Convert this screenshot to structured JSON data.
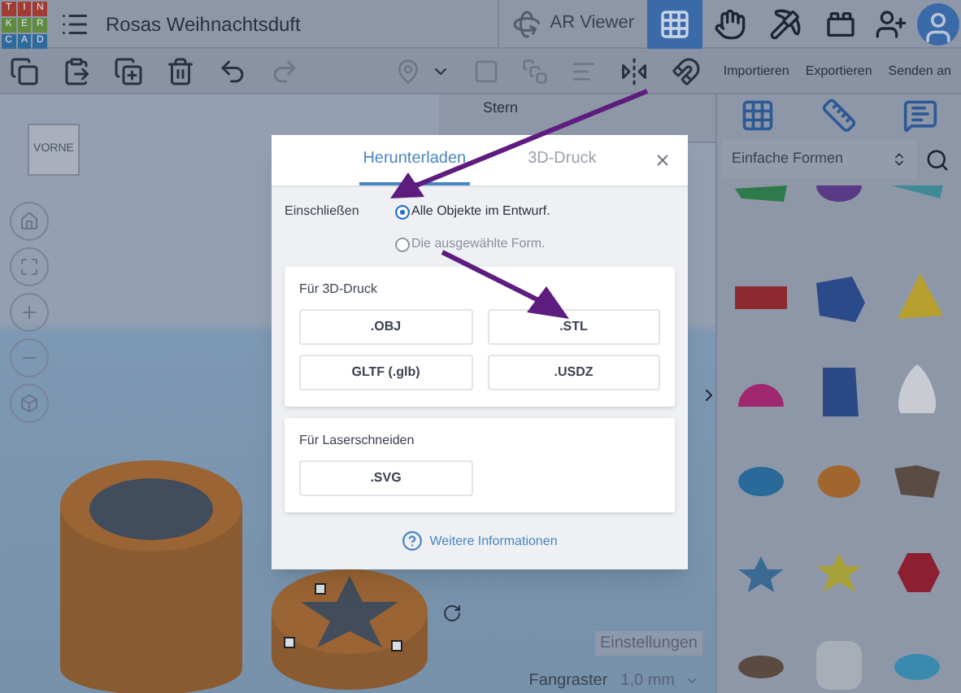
{
  "header": {
    "logo_letters": [
      "T",
      "I",
      "N",
      "K",
      "E",
      "R",
      "C",
      "A",
      "D"
    ],
    "title": "Rosas Weihnachtsduft",
    "ar_viewer": "AR Viewer",
    "view_modes": [
      {
        "kind": "grid",
        "selected": true
      },
      {
        "kind": "hand",
        "selected": false
      },
      {
        "kind": "pickaxe",
        "selected": false
      },
      {
        "kind": "bricks",
        "selected": false
      }
    ]
  },
  "toolbar": {
    "actions": [
      "Importieren",
      "Exportieren",
      "Senden an"
    ]
  },
  "inspector": {
    "title": "Stern"
  },
  "canvas": {
    "view_cube": "VORNE",
    "settings_button": "Einstellungen",
    "snap_grid_label": "Fangraster",
    "snap_grid_value": "1,0 mm"
  },
  "library": {
    "category": "Einfache Formen"
  },
  "dialog": {
    "tabs": [
      {
        "label": "Herunterladen",
        "selected": true
      },
      {
        "label": "3D-Druck",
        "selected": false
      }
    ],
    "include_label": "Einschließen",
    "include_options": [
      {
        "label": "Alle Objekte im Entwurf.",
        "selected": true
      },
      {
        "label": "Die ausgewählte Form.",
        "selected": false
      }
    ],
    "sections": [
      {
        "title": "Für 3D-Druck",
        "formats": [
          ".OBJ",
          ".STL",
          "GLTF (.glb)",
          ".USDZ"
        ]
      },
      {
        "title": "Für Laserschneiden",
        "formats": [
          ".SVG"
        ]
      }
    ],
    "help_link": "Weitere Informationen"
  }
}
